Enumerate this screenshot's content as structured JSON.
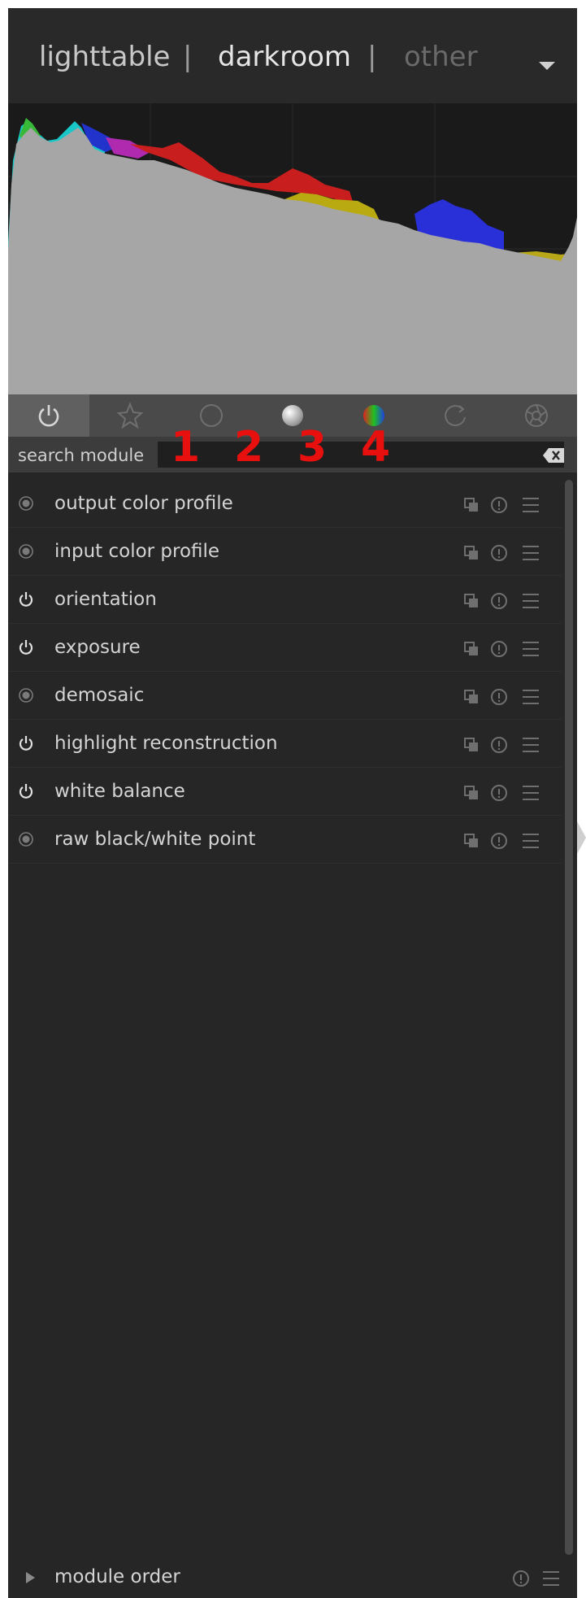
{
  "views": {
    "lighttable": "lighttable",
    "sep1": "|",
    "darkroom": "darkroom",
    "sep2": "|",
    "other": "other"
  },
  "icons": {
    "views_menu": "chevron-down-icon",
    "groups": [
      "power-icon",
      "star-icon",
      "circle-outline-icon",
      "sphere-icon",
      "rgb-circle-icon",
      "rotate-icon",
      "aperture-icon"
    ],
    "module_actions": [
      "copy-icon",
      "info-icon",
      "hamburger-icon"
    ],
    "bottom_actions": [
      "info-icon",
      "hamburger-icon"
    ]
  },
  "annotations": [
    "1",
    "2",
    "3",
    "4"
  ],
  "search": {
    "label": "search module",
    "value": "",
    "placeholder": ""
  },
  "modules": [
    {
      "name": "output color profile",
      "icon": "radio-dot-icon"
    },
    {
      "name": "input color profile",
      "icon": "radio-dot-icon"
    },
    {
      "name": "orientation",
      "icon": "power-icon"
    },
    {
      "name": "exposure",
      "icon": "power-icon"
    },
    {
      "name": "demosaic",
      "icon": "radio-dot-icon"
    },
    {
      "name": "highlight reconstruction",
      "icon": "power-icon"
    },
    {
      "name": "white balance",
      "icon": "power-icon"
    },
    {
      "name": "raw black/white point",
      "icon": "radio-dot-icon"
    }
  ],
  "bottom": {
    "label": "module order"
  },
  "colors": {
    "annotation": "#e8100f",
    "panel": "#262626",
    "histogram_fill": "#a6a6a6"
  }
}
